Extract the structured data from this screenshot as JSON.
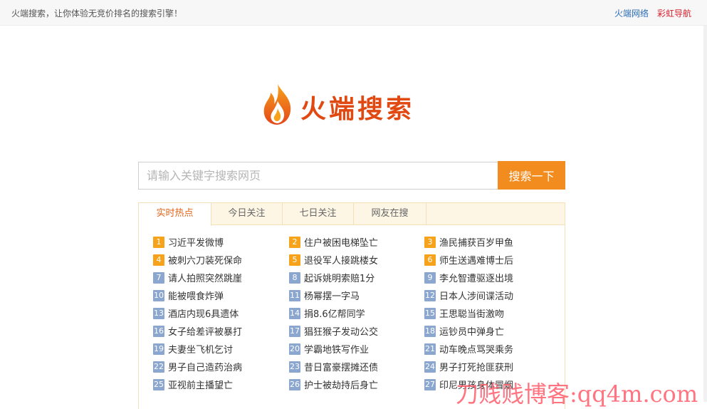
{
  "topbar": {
    "tagline": "火端搜索，让你体验无竞价排名的搜索引擎！",
    "links": [
      "火端网络",
      "彩虹导航"
    ]
  },
  "logo": {
    "text": "火端搜索"
  },
  "search": {
    "placeholder": "请输入关键字搜索网页",
    "button_label": "搜索一下"
  },
  "tabs": [
    "实时热点",
    "今日关注",
    "七日关注",
    "网友在搜"
  ],
  "hot": {
    "active_tab": "实时热点",
    "items": [
      {
        "rank": "1",
        "text": "习近平发微博"
      },
      {
        "rank": "2",
        "text": "住户被困电梯坠亡"
      },
      {
        "rank": "3",
        "text": "渔民捕获百岁甲鱼"
      },
      {
        "rank": "4",
        "text": "被刺六刀装死保命"
      },
      {
        "rank": "5",
        "text": "退役军人接跳楼女"
      },
      {
        "rank": "6",
        "text": "师生送遇难博士后"
      },
      {
        "rank": "7",
        "text": "请人拍照突然跳崖"
      },
      {
        "rank": "8",
        "text": "起诉姚明索赔1分"
      },
      {
        "rank": "9",
        "text": "李允智遭驱逐出境"
      },
      {
        "rank": "10",
        "text": "能被喂食炸弹"
      },
      {
        "rank": "11",
        "text": "杨幂摆一字马"
      },
      {
        "rank": "12",
        "text": "日本人涉间谍活动"
      },
      {
        "rank": "13",
        "text": "酒店内现6具遗体"
      },
      {
        "rank": "14",
        "text": "捐8.6亿帮同学"
      },
      {
        "rank": "15",
        "text": "王思聪当街激吻"
      },
      {
        "rank": "16",
        "text": "女子给差评被暴打"
      },
      {
        "rank": "17",
        "text": "猖狂猴子发动公交"
      },
      {
        "rank": "18",
        "text": "运钞员中弹身亡"
      },
      {
        "rank": "19",
        "text": "夫妻坐飞机乞讨"
      },
      {
        "rank": "20",
        "text": "学霸地铁写作业"
      },
      {
        "rank": "21",
        "text": "动车晚点骂哭乘务"
      },
      {
        "rank": "22",
        "text": "男子自己造药治病"
      },
      {
        "rank": "23",
        "text": "昔日富豪摆摊还债"
      },
      {
        "rank": "24",
        "text": "男子打死抢匪获刑"
      },
      {
        "rank": "25",
        "text": "亚视前主播望亡"
      },
      {
        "rank": "26",
        "text": "护士被劫持后身亡"
      },
      {
        "rank": "27",
        "text": "印尼男孩身体冒烟"
      }
    ]
  },
  "watermark": "刀贱贱博客:qq4m.com"
}
